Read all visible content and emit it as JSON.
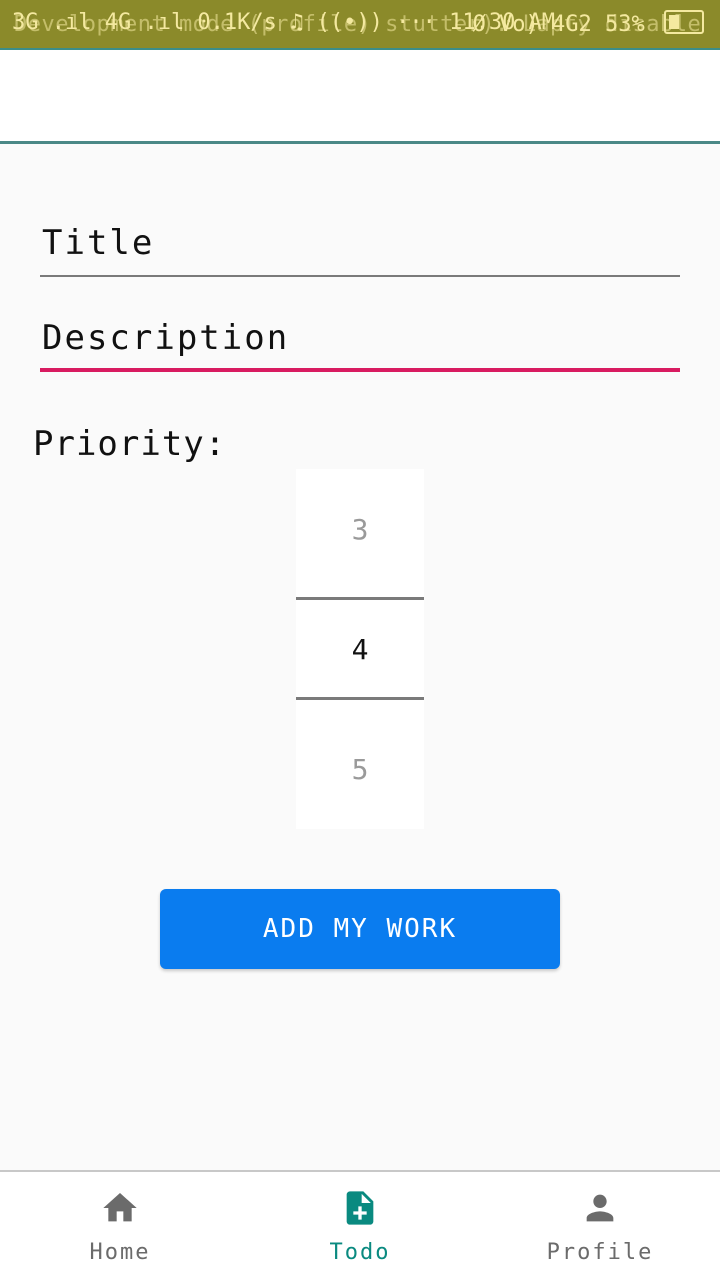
{
  "status_bar": {
    "left": "3G .ıl 4G .ıl 0.1K/s ♫ ((•)) ··· 11:30 AM",
    "overlay": "Development mode (profile) stutter). Lapty disable",
    "right": "Ø Vo) 4G2 53%"
  },
  "form": {
    "title_label": "Title",
    "description_label": "Description",
    "priority_label": "Priority:"
  },
  "picker": {
    "above": "3",
    "selected": "4",
    "below": "5"
  },
  "add_button": "ADD MY WORK",
  "bottom_nav": {
    "items": [
      {
        "label": "Home",
        "icon": "home-icon"
      },
      {
        "label": "Todo",
        "icon": "note-add-icon",
        "active": true
      },
      {
        "label": "Profile",
        "icon": "person-icon"
      }
    ],
    "active_color": "#0a8a80",
    "inactive_color": "#6b6b6b"
  },
  "colors": {
    "status_bar": "#8b8a2a",
    "accent_pink": "#d81b60",
    "button_blue": "#0a7cef"
  }
}
